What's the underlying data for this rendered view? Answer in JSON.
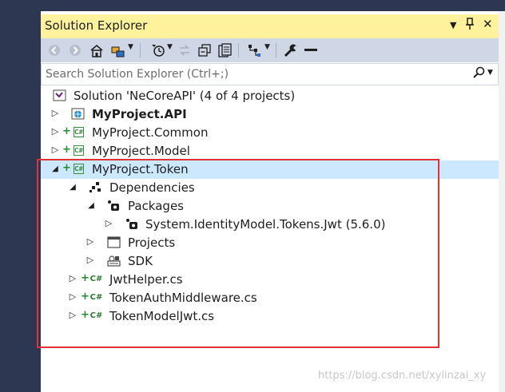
{
  "panel": {
    "title": "Solution Explorer",
    "controls": {
      "dropdown": "▾",
      "pin": "📌",
      "close": "✕"
    }
  },
  "toolbar": {
    "buttons": [
      "back-icon",
      "forward-icon",
      "home-icon",
      "switch-views-icon",
      "pending-changes-filter-icon",
      "sync-icon",
      "collapse-all-icon",
      "show-all-files-icon",
      "properties-view-icon",
      "properties-icon",
      "preview-icon"
    ]
  },
  "search": {
    "placeholder": "Search Solution Explorer (Ctrl+;)"
  },
  "tree": {
    "solution": "Solution 'NeCoreAPI' (4 of 4 projects)",
    "projects": {
      "api": "MyProject.API",
      "common": "MyProject.Common",
      "model": "MyProject.Model",
      "token": "MyProject.Token"
    },
    "dependencies": "Dependencies",
    "packages": "Packages",
    "package_item": "System.IdentityModel.Tokens.Jwt (5.6.0)",
    "projects_node": "Projects",
    "sdk": "SDK",
    "files": {
      "jwt_helper": "JwtHelper.cs",
      "middleware": "TokenAuthMiddleware.cs",
      "model_jwt": "TokenModelJwt.cs"
    }
  },
  "watermark": "https://blog.csdn.net/xylinzai_xy",
  "colors": {
    "title_bar": "#fff29d",
    "toolbar": "#cfd6e5",
    "selection": "#cce8ff",
    "highlight_border": "#e0323a",
    "csharp_green": "#3a8a3f"
  }
}
